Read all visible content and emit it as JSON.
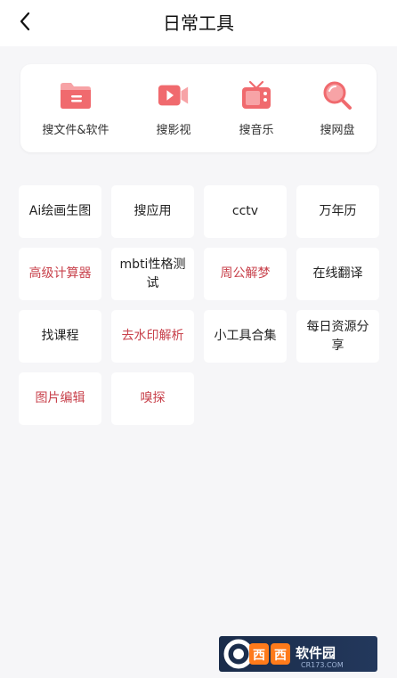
{
  "header": {
    "title": "日常工具",
    "back_icon": "chevron-left-icon"
  },
  "search_bar": {
    "items": [
      {
        "label": "搜文件&软件",
        "icon": "folder-icon"
      },
      {
        "label": "搜影视",
        "icon": "video-camera-icon"
      },
      {
        "label": "搜音乐",
        "icon": "radio-tv-icon"
      },
      {
        "label": "搜网盘",
        "icon": "magnifier-icon"
      }
    ]
  },
  "tools": [
    {
      "label": "Ai绘画生图",
      "accent": false
    },
    {
      "label": "搜应用",
      "accent": false
    },
    {
      "label": "cctv",
      "accent": false
    },
    {
      "label": "万年历",
      "accent": false
    },
    {
      "label": "高级计算器",
      "accent": true
    },
    {
      "label": "mbti性格测试",
      "accent": false
    },
    {
      "label": "周公解梦",
      "accent": true
    },
    {
      "label": "在线翻译",
      "accent": false
    },
    {
      "label": "找课程",
      "accent": false
    },
    {
      "label": "去水印解析",
      "accent": true
    },
    {
      "label": "小工具合集",
      "accent": false
    },
    {
      "label": "每日资源分享",
      "accent": false
    },
    {
      "label": "图片编辑",
      "accent": true
    },
    {
      "label": "嗅探",
      "accent": true
    }
  ],
  "watermark": {
    "label": "西西软件园",
    "sub": "CR173.COM"
  },
  "colors": {
    "accent": "#c8414b",
    "icon_red": "#f06a6e",
    "background": "#f6f6f8"
  }
}
